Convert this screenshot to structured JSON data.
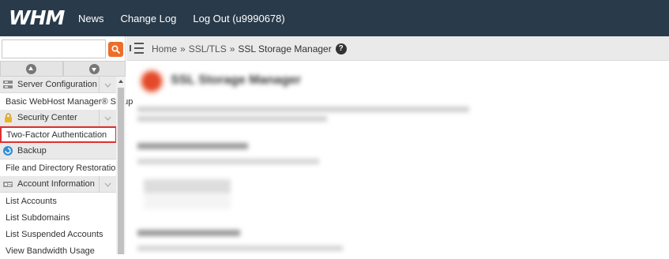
{
  "topbar": {
    "logo": "WHM",
    "nav": [
      "News",
      "Change Log",
      "Log Out (u9990678)"
    ]
  },
  "sidebar": {
    "search": {
      "value": "",
      "placeholder": ""
    },
    "menu": [
      {
        "type": "category",
        "label": "Server Configuration",
        "icon": "server-config-icon"
      },
      {
        "type": "item",
        "label": "Basic WebHost Manager® Setup"
      },
      {
        "type": "category",
        "label": "Security Center",
        "icon": "lock-icon"
      },
      {
        "type": "item",
        "label": "Two-Factor Authentication",
        "active": true
      },
      {
        "type": "category",
        "label": "Backup",
        "icon": "backup-icon"
      },
      {
        "type": "item",
        "label": "File and Directory Restoration"
      },
      {
        "type": "category",
        "label": "Account Information",
        "icon": "account-info-icon"
      },
      {
        "type": "item",
        "label": "List Accounts"
      },
      {
        "type": "item",
        "label": "List Subdomains"
      },
      {
        "type": "item",
        "label": "List Suspended Accounts"
      },
      {
        "type": "item",
        "label": "View Bandwidth Usage"
      }
    ]
  },
  "breadcrumb": {
    "home": "Home",
    "sep": "»",
    "section": "SSL/TLS",
    "current": "SSL Storage Manager"
  },
  "main": {
    "title": "SSL Storage Manager"
  },
  "colors": {
    "topbar": "#293a4a",
    "search_button": "#ec6e29",
    "active_outline": "#e0302f"
  }
}
